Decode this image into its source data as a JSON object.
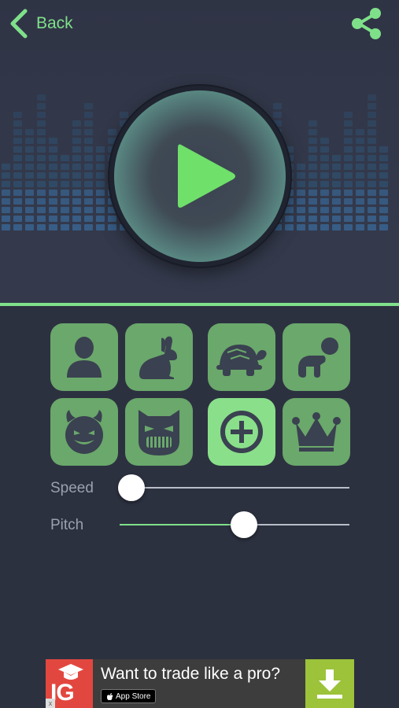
{
  "nav": {
    "back_label": "Back",
    "back_icon": "chevron-left-icon",
    "share_icon": "share-icon"
  },
  "player": {
    "play_icon": "play-icon"
  },
  "effects": [
    {
      "name": "normal",
      "icon": "person-icon",
      "active": false
    },
    {
      "name": "rabbit",
      "icon": "rabbit-icon",
      "active": false
    },
    {
      "name": "turtle",
      "icon": "turtle-icon",
      "active": false
    },
    {
      "name": "baby",
      "icon": "baby-icon",
      "active": false
    },
    {
      "name": "devil",
      "icon": "devil-icon",
      "active": false
    },
    {
      "name": "robot",
      "icon": "robot-icon",
      "active": false
    },
    {
      "name": "add-custom",
      "icon": "plus-icon",
      "active": true
    },
    {
      "name": "king",
      "icon": "crown-icon",
      "active": false
    }
  ],
  "sliders": {
    "speed": {
      "label": "Speed",
      "value": 0.0
    },
    "pitch": {
      "label": "Pitch",
      "value": 0.54
    }
  },
  "ad": {
    "logo_text": "IG",
    "title": "Want to trade like a pro?",
    "store_label": "App Store",
    "download_icon": "download-icon",
    "close_label": "x"
  },
  "colors": {
    "accent": "#7fe08a",
    "background": "#2c3140",
    "button": "#6aa86b",
    "button_active": "#8adf8a",
    "icon_dark": "#3a4150",
    "ad_red": "#e2473f",
    "ad_green": "#9cc33a"
  }
}
